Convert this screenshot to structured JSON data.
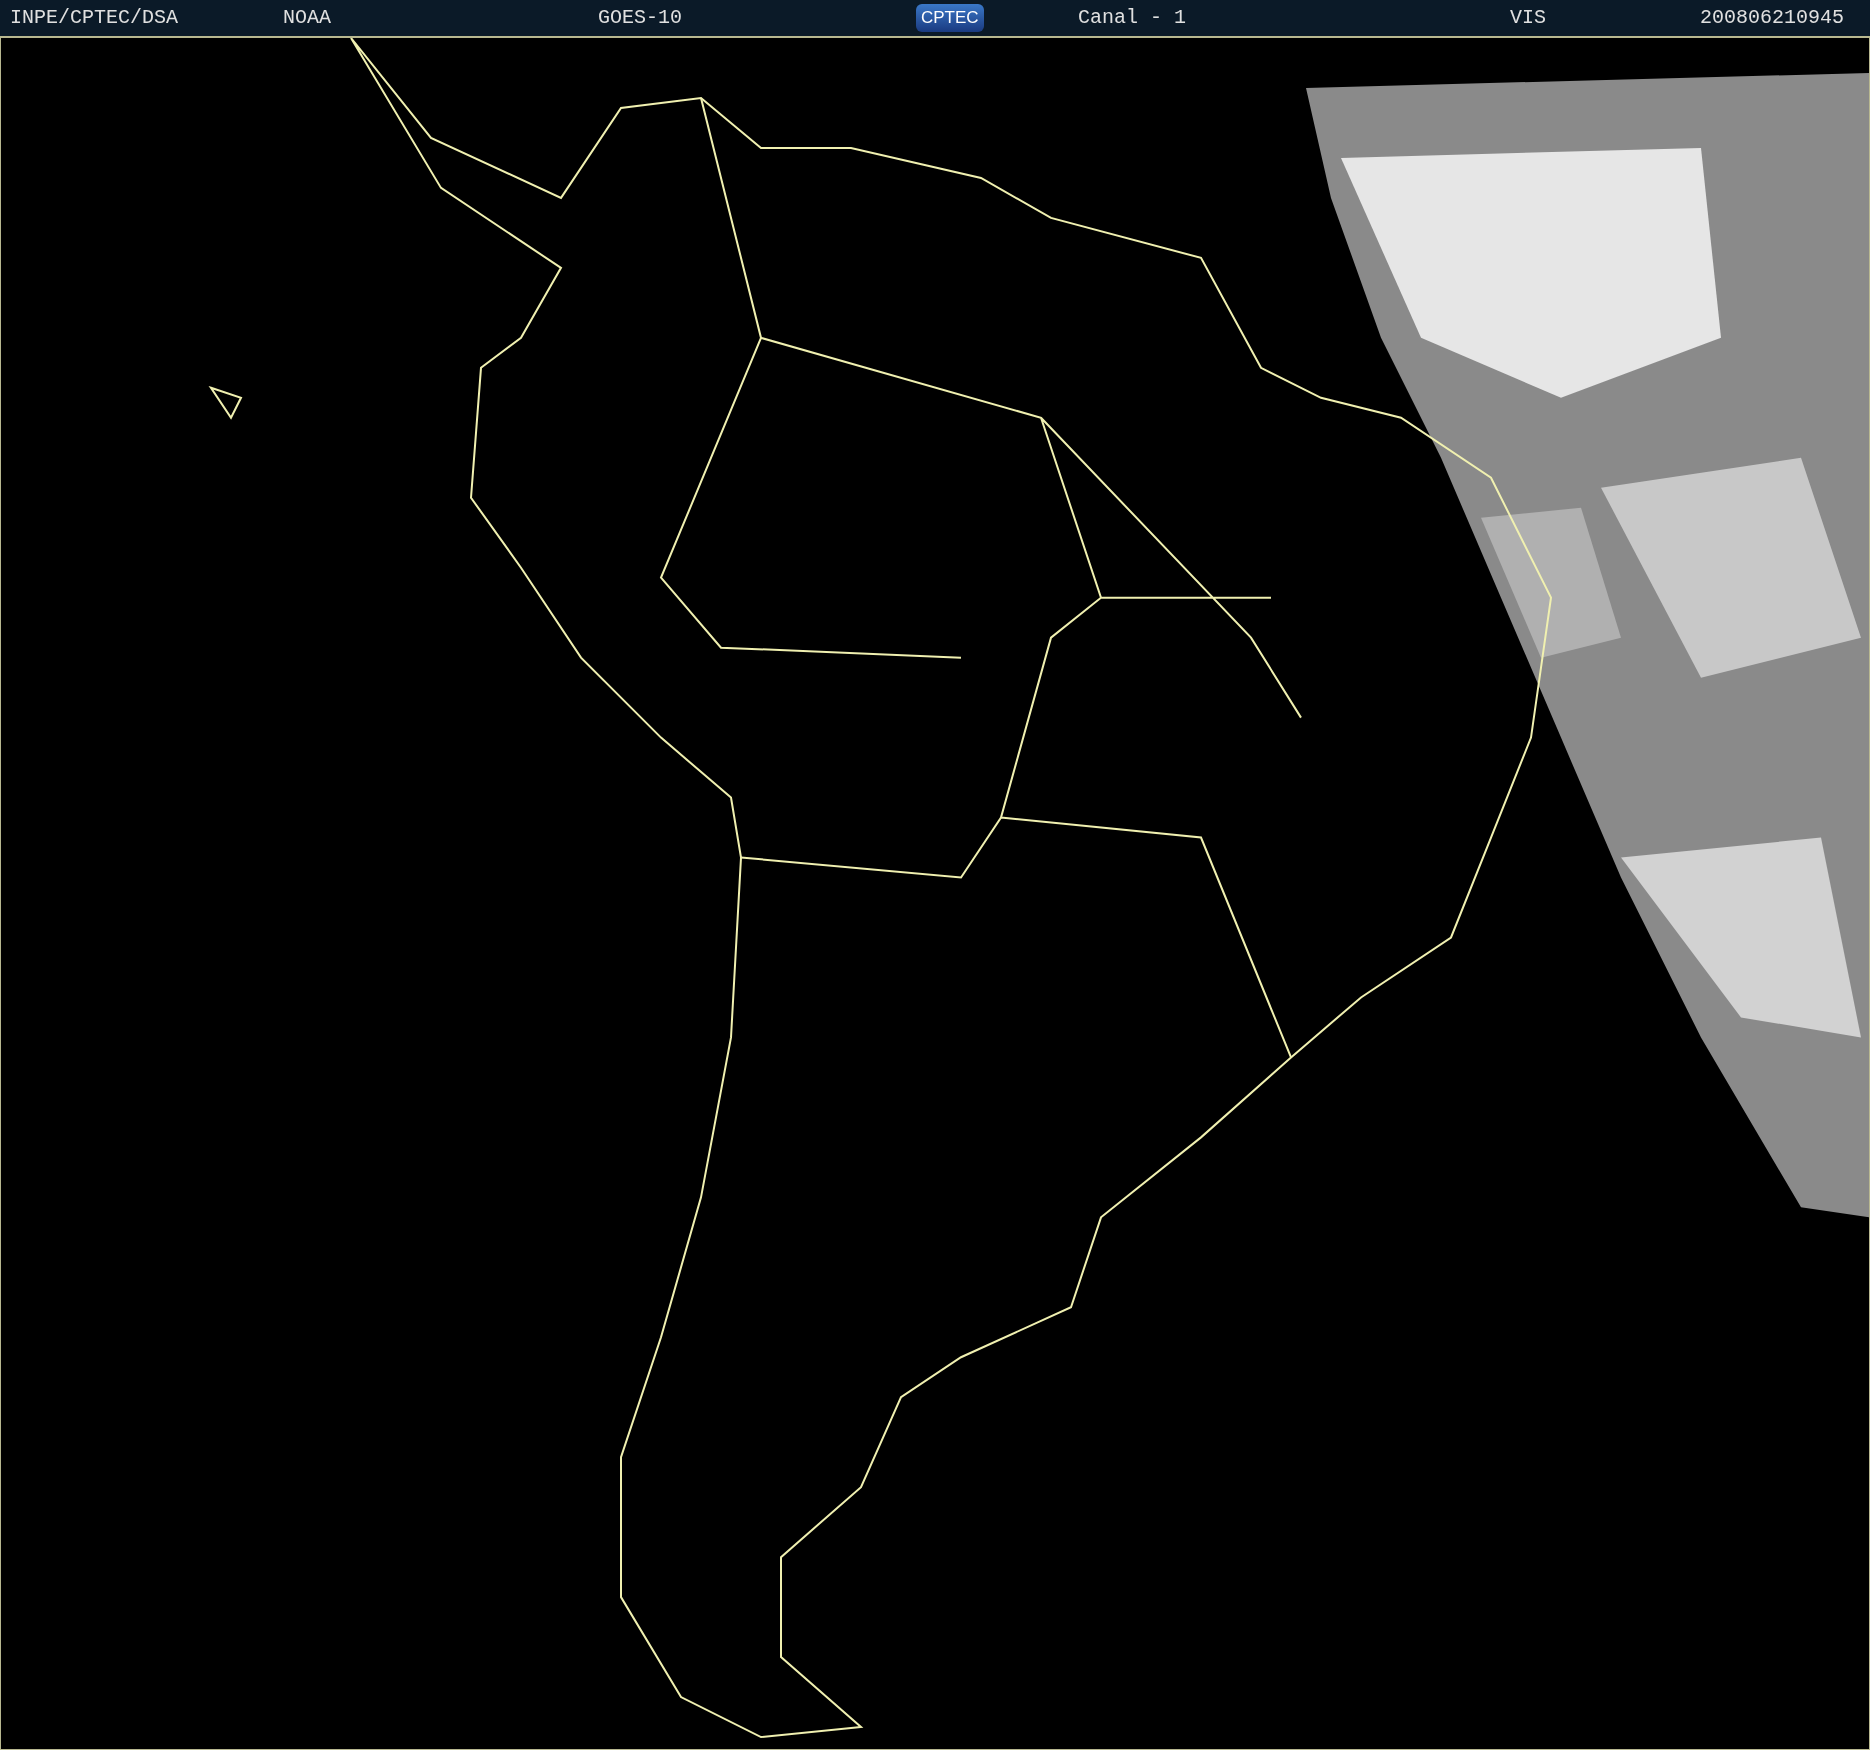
{
  "header": {
    "source": "INPE/CPTEC/DSA",
    "agency": "NOAA",
    "satellite": "GOES-10",
    "logo": "CPTEC",
    "channel": "Canal - 1",
    "band": "VIS",
    "timestamp": "200806210945"
  }
}
